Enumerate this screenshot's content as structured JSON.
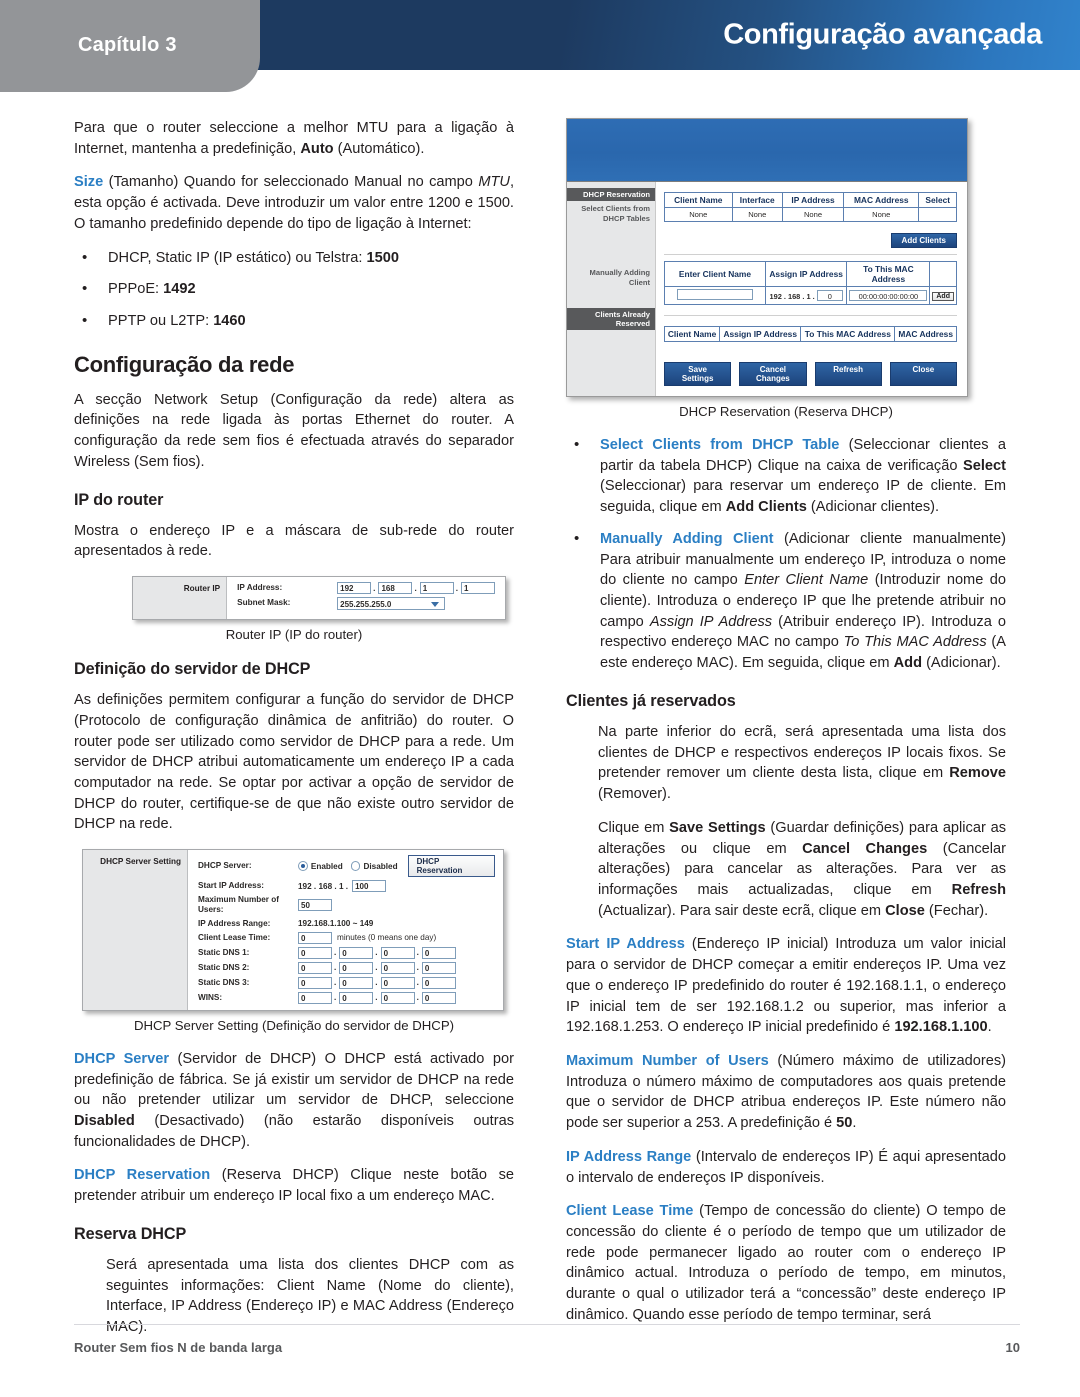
{
  "header": {
    "chapter_label": "Capítulo 3",
    "title": "Configuração avançada",
    "accent_dark": "#1d3a60",
    "accent_light": "#3183cc",
    "tab_gray": "#939598"
  },
  "left_column": {
    "p_mtu": "Para que o router seleccione a melhor MTU para a ligação à Internet, mantenha a predefinição, ",
    "p_mtu_bold": "Auto",
    "p_mtu_tail": " (Automático).",
    "size_kw": "Size",
    "size_text_1": " (Tamanho) Quando for seleccionado Manual no campo ",
    "size_italic": "MTU",
    "size_text_2": ", esta opção é activada. Deve introduzir um valor entre 1200 e 1500. O tamanho predefinido depende do tipo de ligação à Internet:",
    "bullets": [
      {
        "text": "DHCP, Static IP (IP estático) ou Telstra: ",
        "value": "1500"
      },
      {
        "text": "PPPoE: ",
        "value": "1492"
      },
      {
        "text": "PPTP ou L2TP: ",
        "value": "1460"
      }
    ],
    "h_network_setup": "Configuração da rede",
    "p_network_setup": "A secção Network Setup (Configuração da rede) altera as definições na rede ligada às portas Ethernet do router. A configuração da rede sem fios é efectuada através do separador Wireless (Sem fios).",
    "h_router_ip": "IP do router",
    "p_router_ip": "Mostra o endereço IP e a máscara de sub-rede do router apresentados à rede.",
    "h_dhcp_server_setting": "Definição do servidor de DHCP",
    "p_dhcp_server_setting": "As definições permitem configurar a função do servidor de DHCP (Protocolo de configuração dinâmica de anfitrião) do router. O router pode ser utilizado como servidor de DHCP para a rede. Um servidor de DHCP atribui automaticamente um endereço IP a cada computador na rede. Se optar por activar a opção de servidor de DHCP do router, certifique-se de que não existe outro servidor de DHCP na rede.",
    "dhcp_server_kw": "DHCP Server",
    "dhcp_server_text_1": " (Servidor de DHCP) O DHCP está activado por predefinição de fábrica. Se já existir um servidor de DHCP na rede ou não pretender utilizar um servidor de DHCP, seleccione ",
    "dhcp_server_bold": "Disabled",
    "dhcp_server_text_2": " (Desactivado) (não estarão disponíveis outras funcionalidades de DHCP).",
    "dhcp_reservation_kw": "DHCP Reservation",
    "dhcp_reservation_text": " (Reserva DHCP) Clique neste botão se pretender atribuir um endereço IP local fixo a um endereço MAC.",
    "h_reserva_dhcp": "Reserva DHCP",
    "p_reserva_dhcp": "Será apresentada uma lista dos clientes DHCP com as seguintes informações: Client Name (Nome do cliente), Interface, IP Address (Endereço IP) e MAC Address (Endereço MAC)."
  },
  "right_column": {
    "bullet_select_kw": "Select Clients from DHCP Table",
    "bullet_select_text_1": " (Seleccionar clientes a partir da tabela DHCP) Clique na caixa de verificação ",
    "bullet_select_bold_1": "Select",
    "bullet_select_text_2": " (Seleccionar) para reservar um endereço IP de cliente. Em seguida, clique em ",
    "bullet_select_bold_2": "Add Clients",
    "bullet_select_text_3": " (Adicionar clientes).",
    "bullet_manual_kw": "Manually Adding Client",
    "bullet_manual_text_1": " (Adicionar cliente manualmente) Para atribuir manualmente um endereço IP, introduza o nome do cliente no campo ",
    "bullet_manual_i1": "Enter Client Name",
    "bullet_manual_text_2": " (Introduzir nome do cliente). Introduza o endereço IP que lhe pretende atribuir no campo ",
    "bullet_manual_i2": "Assign IP Address",
    "bullet_manual_text_3": " (Atribuir endereço IP). Introduza o respectivo endereço MAC no campo ",
    "bullet_manual_i3": "To This MAC Address",
    "bullet_manual_text_4": " (A este endereço MAC). Em seguida, clique em ",
    "bullet_manual_bold": "Add",
    "bullet_manual_text_5": " (Adicionar).",
    "h_clientes_reservados": "Clientes já reservados",
    "p_clientes_1a": "Na parte inferior do ecrã, será apresentada uma lista dos clientes de DHCP e respectivos endereços IP locais fixos. Se pretender remover um cliente desta lista, clique em ",
    "p_clientes_1b": "Remove",
    "p_clientes_1c": " (Remover).",
    "p_clientes_2a": "Clique em ",
    "p_clientes_2b": "Save Settings",
    "p_clientes_2c": " (Guardar definições) para aplicar as alterações ou clique em ",
    "p_clientes_2d": "Cancel Changes",
    "p_clientes_2e": " (Cancelar alterações) para cancelar as alterações. Para ver as informações mais actualizadas, clique em ",
    "p_clientes_2f": "Refresh",
    "p_clientes_2g": " (Actualizar). Para sair deste ecrã, clique em ",
    "p_clientes_2h": "Close",
    "p_clientes_2i": " (Fechar).",
    "start_ip_kw": "Start IP Address",
    "start_ip_text_1": " (Endereço IP inicial) Introduza um valor inicial para o servidor de DHCP começar a emitir endereços IP. Uma vez que o endereço IP predefinido do router é 192.168.1.1, o endereço IP inicial tem de ser 192.168.1.2 ou superior, mas inferior a 192.168.1.253. O endereço IP inicial predefinido é ",
    "start_ip_bold": "192.168.1.100",
    "start_ip_text_2": ".",
    "max_users_kw": "Maximum Number of Users",
    "max_users_text_1": " (Número máximo de utilizadores) Introduza o número máximo de computadores aos quais pretende que o servidor de DHCP atribua endereços IP. Este número não pode ser superior a 253. A predefinição é ",
    "max_users_bold": "50",
    "max_users_text_2": ".",
    "ip_range_kw": "IP Address Range",
    "ip_range_text": " (Intervalo de endereços IP) É aqui apresentado o intervalo de endereços IP disponíveis.",
    "lease_kw": "Client Lease Time",
    "lease_text": " (Tempo de concessão do cliente) O tempo de concessão do cliente é o período de tempo que um utilizador de rede pode permanecer ligado ao router com o endereço IP dinâmico actual. Introduza o período de tempo, em minutos, durante o qual o utilizador terá a “concessão” deste endereço IP dinâmico. Quando esse período de tempo terminar, será"
  },
  "figures": {
    "router_ip": {
      "caption": "Router IP (IP do router)",
      "side_label": "Router IP",
      "fields": [
        {
          "label": "IP Address:",
          "octets": [
            "192",
            "168",
            "1",
            "1"
          ]
        },
        {
          "label": "Subnet Mask:",
          "value": "255.255.255.0"
        }
      ]
    },
    "dhcp_server_setting": {
      "caption": "DHCP Server Setting (Definição do servidor de DHCP)",
      "side_label": "DHCP Server Setting",
      "dhcp_server_label": "DHCP Server:",
      "enabled_label": "Enabled",
      "disabled_label": "Disabled",
      "reservation_button": "DHCP Reservation",
      "start_ip_label": "Start IP Address:",
      "start_ip_prefix": "192 . 168 . 1 .",
      "start_ip_value": "100",
      "max_users_label": "Maximum Number of Users:",
      "max_users_value": "50",
      "ip_range_label": "IP Address Range:",
      "ip_range_value": "192.168.1.100 ~ 149",
      "lease_label": "Client Lease Time:",
      "lease_value": "0",
      "lease_suffix": "minutes (0 means one day)",
      "dns_rows": [
        {
          "label": "Static DNS 1:",
          "octets": [
            "0",
            "0",
            "0",
            "0"
          ]
        },
        {
          "label": "Static DNS 2:",
          "octets": [
            "0",
            "0",
            "0",
            "0"
          ]
        },
        {
          "label": "Static DNS 3:",
          "octets": [
            "0",
            "0",
            "0",
            "0"
          ]
        },
        {
          "label": "WINS:",
          "octets": [
            "0",
            "0",
            "0",
            "0"
          ]
        }
      ]
    },
    "dhcp_reservation": {
      "caption": "DHCP Reservation (Reserva DHCP)",
      "side_heading": "DHCP Reservation",
      "side_sub_1": "Select Clients from DHCP Tables",
      "side_sub_2": "Manually Adding Client",
      "side_heading_2": "Clients Already Reserved",
      "table1_headers": [
        "Client Name",
        "Interface",
        "IP Address",
        "MAC Address",
        "Select"
      ],
      "table1_row": [
        "None",
        "None",
        "None",
        "None",
        ""
      ],
      "add_clients_button": "Add Clients",
      "table2_headers": [
        "Enter Client Name",
        "Assign IP Address",
        "To This MAC Address",
        ""
      ],
      "table2_ip_prefix": "192 . 168 . 1 .",
      "table2_ip_value": "0",
      "table2_mac_value": "00:00:00:00:00:00",
      "table2_add_button": "Add",
      "table3_headers": [
        "Client Name",
        "Assign IP Address",
        "To This MAC Address",
        "MAC Address"
      ],
      "buttons": [
        "Save Settings",
        "Cancel Changes",
        "Refresh",
        "Close"
      ]
    }
  },
  "footer": {
    "product": "Router Sem fios N de banda larga",
    "page_number": "10"
  }
}
